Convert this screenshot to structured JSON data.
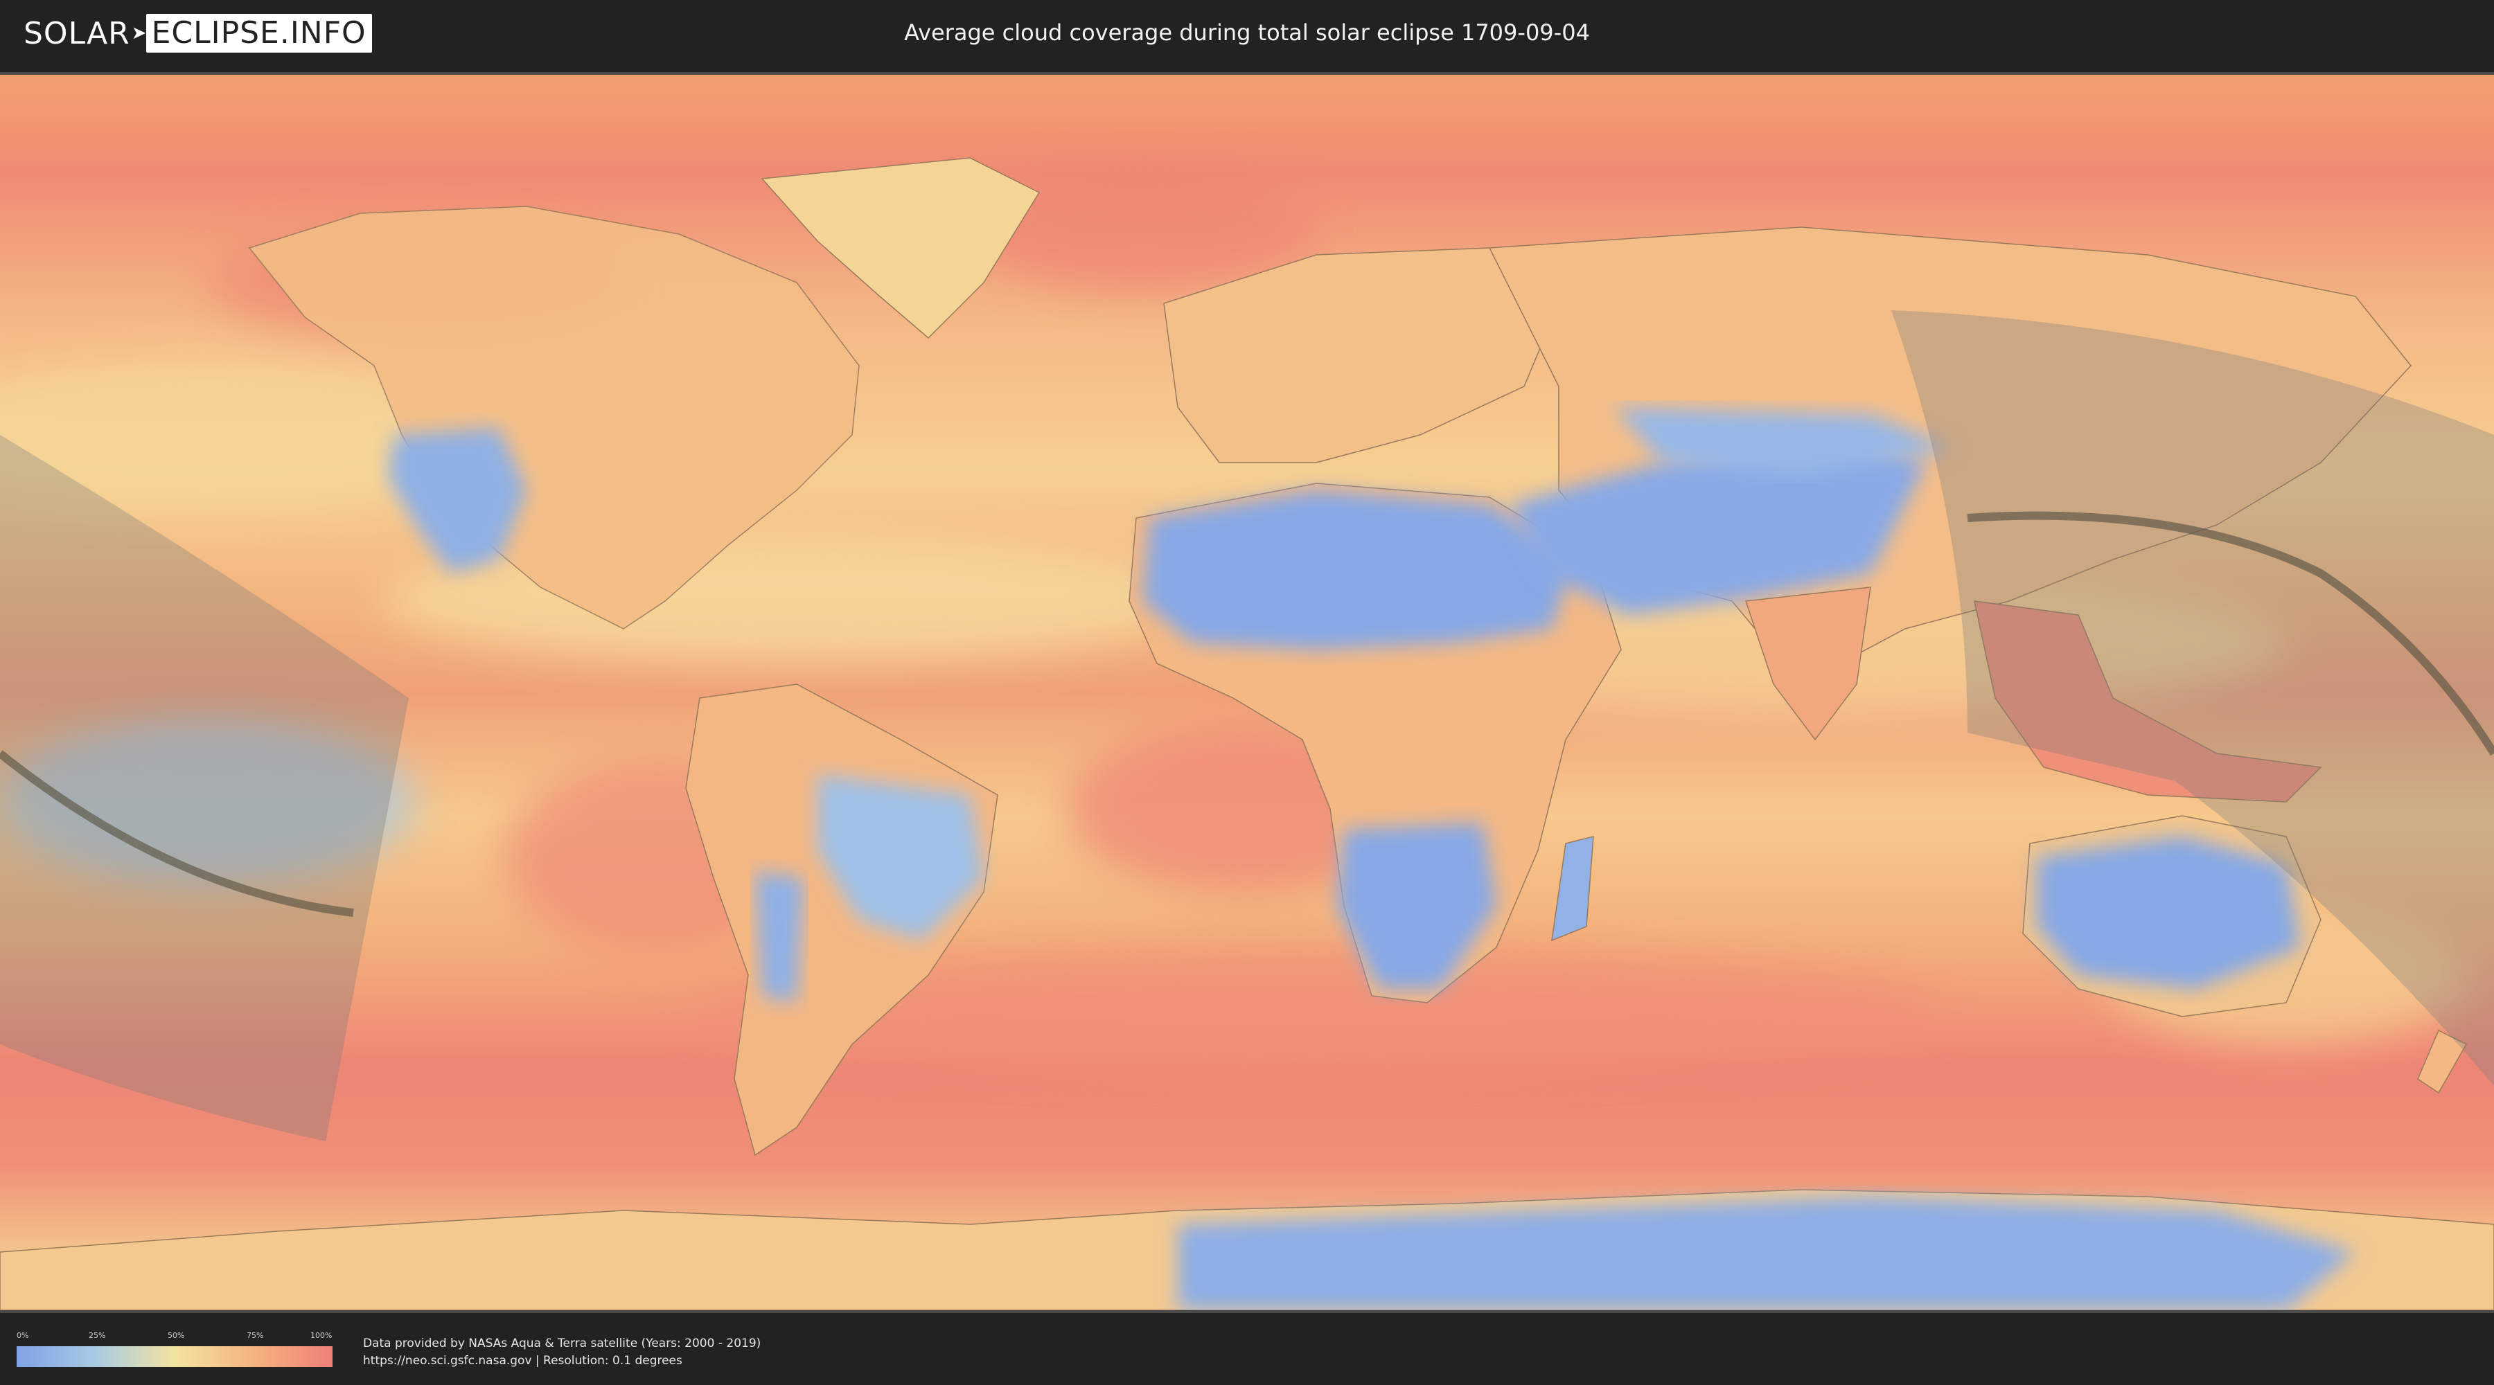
{
  "header": {
    "logo_left": "SOLAR",
    "logo_right": "ECLIPSE.INFO",
    "title": "Average cloud coverage during total solar eclipse 1709-09-04"
  },
  "map": {
    "overlay_color": "#7a7a7a",
    "centerline_color": "#5a5544",
    "palette": {
      "clear": "#7ea2e6",
      "low": "#a8cbe3",
      "mid": "#f2e3a0",
      "high": "#f5b47e",
      "overcast": "#ef8078"
    }
  },
  "legend": {
    "ticks": [
      "0%",
      "25%",
      "50%",
      "75%",
      "100%"
    ],
    "gradient": [
      "#7ea2e6",
      "#a8cbe3",
      "#f2e3a0",
      "#f5b47e",
      "#ef8078"
    ]
  },
  "credits": {
    "line1": "Data provided by NASAs Aqua & Terra satellite (Years: 2000 - 2019)",
    "line2": "https://neo.sci.gsfc.nasa.gov | Resolution: 0.1 degrees"
  }
}
